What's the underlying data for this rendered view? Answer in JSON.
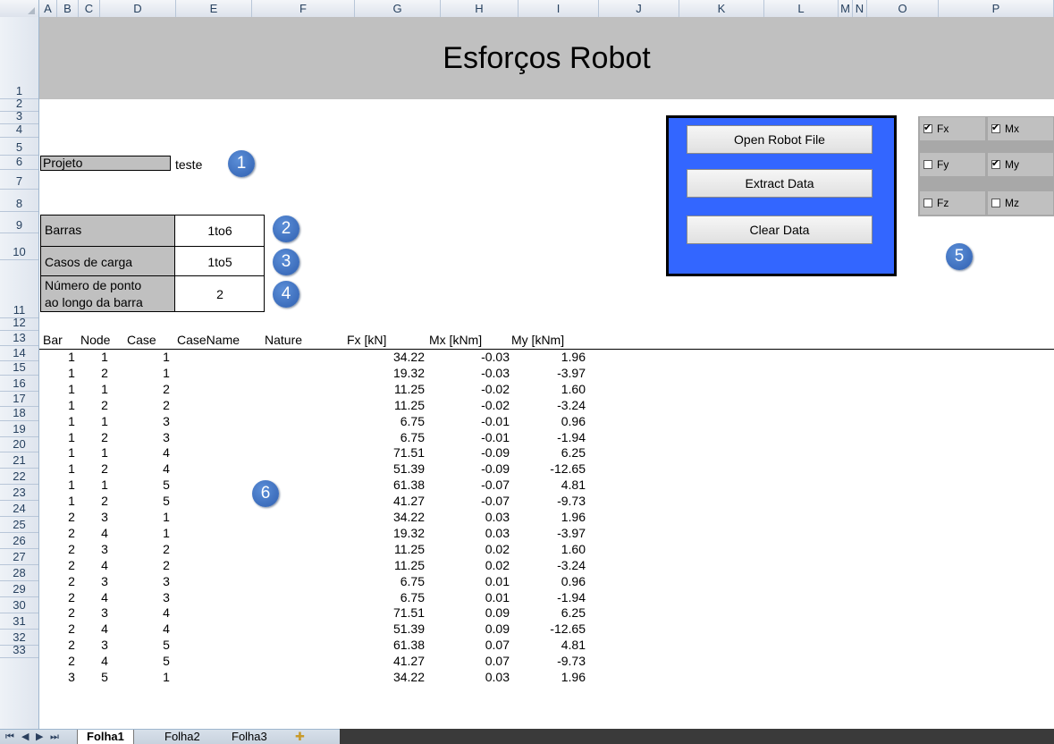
{
  "columns": [
    "A",
    "B",
    "C",
    "D",
    "E",
    "F",
    "G",
    "H",
    "I",
    "J",
    "K",
    "L",
    "M",
    "N",
    "O",
    "P"
  ],
  "rows": [
    "1",
    "2",
    "3",
    "4",
    "5",
    "6",
    "7",
    "8",
    "9",
    "10",
    "11",
    "12",
    "13",
    "14",
    "15",
    "16",
    "17",
    "18",
    "19",
    "20",
    "21",
    "22",
    "23",
    "24",
    "25",
    "26",
    "27",
    "28",
    "29",
    "30",
    "31",
    "32",
    "33"
  ],
  "title": "Esforços Robot",
  "form": {
    "projeto_label": "Projeto",
    "projeto_value": "teste",
    "barras_label": "Barras",
    "barras_value": "1to6",
    "casos_label": "Casos de carga",
    "casos_value": "1to5",
    "pontos_label_1": "Número de ponto",
    "pontos_label_2": "ao longo da barra",
    "pontos_value": "2"
  },
  "callouts": [
    "1",
    "2",
    "3",
    "4",
    "5",
    "6"
  ],
  "buttons": {
    "open": "Open Robot File",
    "extract": "Extract Data",
    "clear": "Clear Data"
  },
  "checkboxes": [
    {
      "label": "Fx",
      "checked": true
    },
    {
      "label": "Mx",
      "checked": true
    },
    {
      "label": "Fy",
      "checked": false
    },
    {
      "label": "My",
      "checked": true
    },
    {
      "label": "Fz",
      "checked": false
    },
    {
      "label": "Mz",
      "checked": false
    }
  ],
  "table": {
    "headers": [
      "Bar",
      "Node",
      "Case",
      "CaseName",
      "Nature",
      "Fx [kN]",
      "Mx [kNm]",
      "My [kNm]"
    ],
    "rows": [
      [
        "1",
        "1",
        "1",
        "34.22",
        "-0.03",
        "1.96"
      ],
      [
        "1",
        "2",
        "1",
        "19.32",
        "-0.03",
        "-3.97"
      ],
      [
        "1",
        "1",
        "2",
        "11.25",
        "-0.02",
        "1.60"
      ],
      [
        "1",
        "2",
        "2",
        "11.25",
        "-0.02",
        "-3.24"
      ],
      [
        "1",
        "1",
        "3",
        "6.75",
        "-0.01",
        "0.96"
      ],
      [
        "1",
        "2",
        "3",
        "6.75",
        "-0.01",
        "-1.94"
      ],
      [
        "1",
        "1",
        "4",
        "71.51",
        "-0.09",
        "6.25"
      ],
      [
        "1",
        "2",
        "4",
        "51.39",
        "-0.09",
        "-12.65"
      ],
      [
        "1",
        "1",
        "5",
        "61.38",
        "-0.07",
        "4.81"
      ],
      [
        "1",
        "2",
        "5",
        "41.27",
        "-0.07",
        "-9.73"
      ],
      [
        "2",
        "3",
        "1",
        "34.22",
        "0.03",
        "1.96"
      ],
      [
        "2",
        "4",
        "1",
        "19.32",
        "0.03",
        "-3.97"
      ],
      [
        "2",
        "3",
        "2",
        "11.25",
        "0.02",
        "1.60"
      ],
      [
        "2",
        "4",
        "2",
        "11.25",
        "0.02",
        "-3.24"
      ],
      [
        "2",
        "3",
        "3",
        "6.75",
        "0.01",
        "0.96"
      ],
      [
        "2",
        "4",
        "3",
        "6.75",
        "0.01",
        "-1.94"
      ],
      [
        "2",
        "3",
        "4",
        "71.51",
        "0.09",
        "6.25"
      ],
      [
        "2",
        "4",
        "4",
        "51.39",
        "0.09",
        "-12.65"
      ],
      [
        "2",
        "3",
        "5",
        "61.38",
        "0.07",
        "4.81"
      ],
      [
        "2",
        "4",
        "5",
        "41.27",
        "0.07",
        "-9.73"
      ],
      [
        "3",
        "5",
        "1",
        "34.22",
        "0.03",
        "1.96"
      ]
    ]
  },
  "tabs": [
    "Folha1",
    "Folha2",
    "Folha3"
  ],
  "colors": {
    "panel_blue": "#3366ff",
    "callout_blue": "#3d6fc4",
    "form_gray": "#c0c0c0"
  }
}
